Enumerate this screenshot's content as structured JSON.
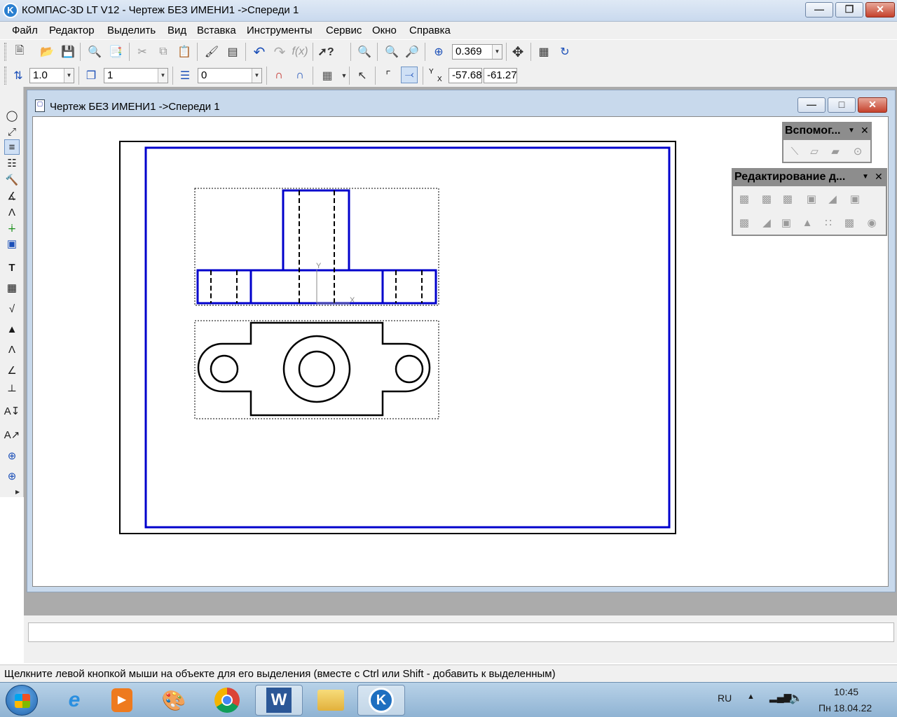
{
  "window": {
    "title": "КОМПАС-3D LT V12 - Чертеж БЕЗ ИМЕНИ1 ->Спереди 1",
    "app_icon_letter": "K"
  },
  "menu": [
    "Файл",
    "Редактор",
    "Выделить",
    "Вид",
    "Вставка",
    "Инструменты",
    "Сервис",
    "Окно",
    "Справка"
  ],
  "toolbar_top": {
    "zoom_value": "0.369"
  },
  "toolbar_second": {
    "step_value": "1.0",
    "layer_value": "1",
    "style_value": "0",
    "coord_x": "-57.68",
    "coord_y": "-61.27",
    "coord_y_label": "Y",
    "coord_x_label": "X"
  },
  "document": {
    "title": "Чертеж БЕЗ ИМЕНИ1 ->Спереди 1",
    "axis_x_label": "X",
    "axis_y_label": "Y"
  },
  "panels": {
    "aux_title": "Вспомог...",
    "edit_title": "Редактирование д..."
  },
  "status": {
    "text": "Щелкните левой кнопкой мыши на объекте для его выделения (вместе с Ctrl или Shift - добавить к выделенным)"
  },
  "taskbar": {
    "language": "RU",
    "time": "10:45",
    "date": "Пн 18.04.22"
  },
  "colors": {
    "drawing_blue": "#0000cc",
    "drawing_black": "#000000"
  }
}
